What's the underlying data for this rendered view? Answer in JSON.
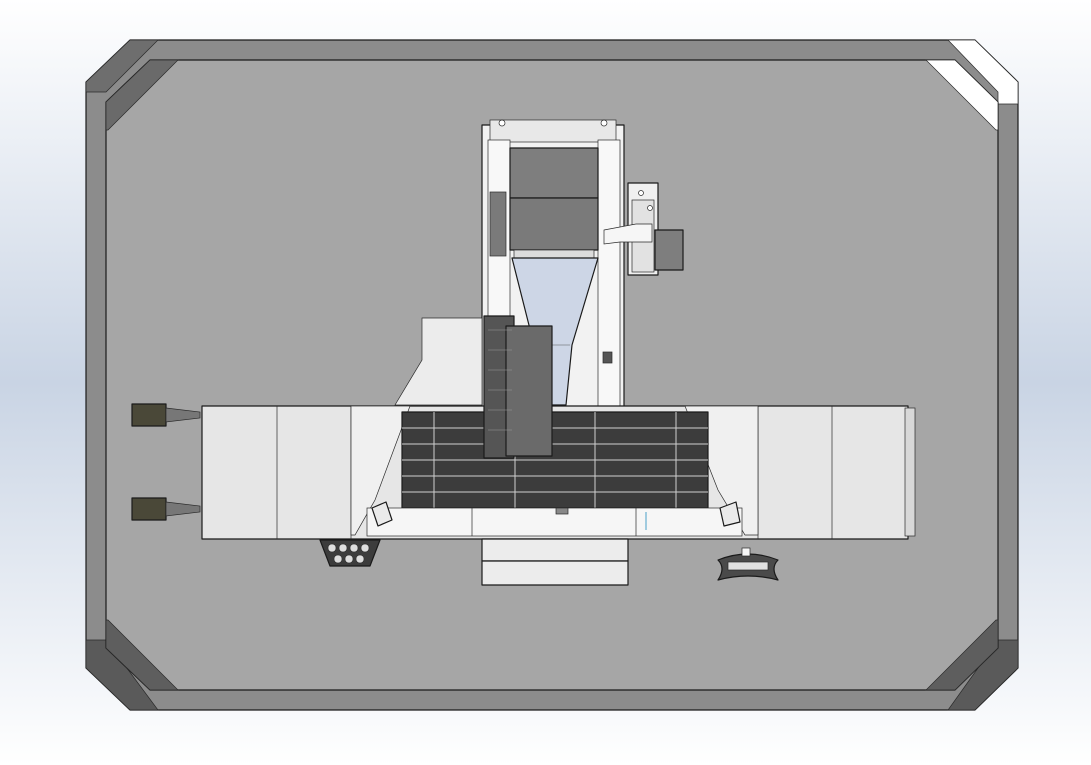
{
  "viewport": {
    "background_top": "#ffffff",
    "background_mid": "#c9d4e4",
    "background_bottom": "#ffffff"
  },
  "palette": {
    "enclosure_outer": "#8c8c8c",
    "enclosure_bevel_dark": "#5a5a5a",
    "enclosure_bevel_light": "#ffffff",
    "floor": "#a6a6a6",
    "panel_light": "#e6e6e6",
    "panel_white": "#f4f4f4",
    "steel_dark": "#3c3c3c",
    "steel_mid": "#7a7a7a",
    "glass_blue": "#cdd6e6",
    "handle_olive": "#4a4838"
  }
}
